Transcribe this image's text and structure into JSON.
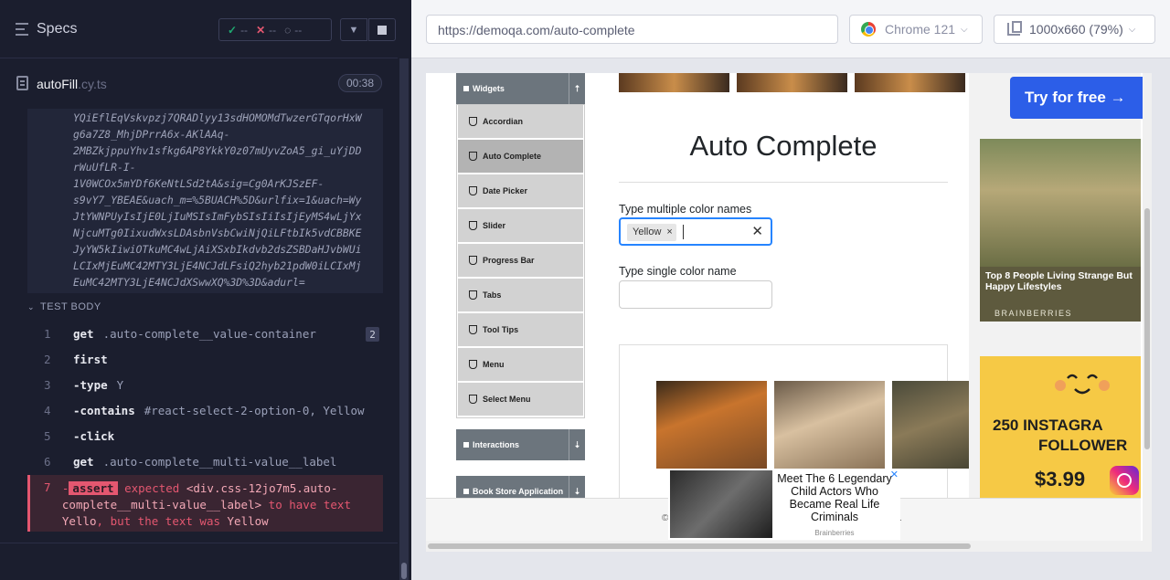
{
  "specs": {
    "title": "Specs",
    "stats": {
      "passed": "--",
      "failed": "--",
      "pending": "--"
    }
  },
  "spec_file": {
    "name": "autoFill",
    "ext": ".cy.ts",
    "time": "00:38"
  },
  "url_fragment": "YQiEflEqVskvpzj7QRADlyy13sdHOMOMdTwzerGTqorHxW\ng6a7Z8_MhjDPrrA6x-AKlAAq-\n2MBZkjppuYhv1sfkg6AP8YkkY0z07mUyvZoA5_gi_uYjDD\nrWuUfLR-I-\n1V0WCOx5mYDf6KeNtLSd2tA&sig=Cg0ArKJSzEF-\ns9vY7_YBEAE&uach_m=%5BUACH%5D&urlfix=1&uach=Wy\nJtYWNPUyIsIjE0LjIuMSIsImFybSIsIiIsIjEyMS4wLjYx\nNjcuMTg0IixudWxsLDAsbnVsbCwiNjQiLFtbIk5vdCBBKE\nJyYW5kIiwiOTkuMC4wLjAiXSxbIkdvb2dsZSBDaHJvbWUi\nLCIxMjEuMC42MTY3LjE4NCJdLFsiQ2hyb21pdW0iLCIxMj\nEuMC42MTY3LjE4NCJdXSwwXQ%3D%3D&adurl=",
  "test_body": {
    "header": "TEST BODY",
    "commands": [
      {
        "num": "1",
        "name": "get",
        "msg": ".auto-complete__value-container",
        "badge": "2"
      },
      {
        "num": "2",
        "name": "first",
        "msg": ""
      },
      {
        "num": "3",
        "name": "-type",
        "msg": "Y"
      },
      {
        "num": "4",
        "name": "-contains",
        "msg": "#react-select-2-option-0, Yellow"
      },
      {
        "num": "5",
        "name": "-click",
        "msg": ""
      },
      {
        "num": "6",
        "name": "get",
        "msg": ".auto-complete__multi-value__label"
      }
    ],
    "error": {
      "num": "7",
      "prefix": "-",
      "assert": "assert",
      "expected": "expected",
      "selector": "<div.css-12jo7m5.auto-complete__multi-value__label>",
      "to_have_text": "to have text",
      "expected_text": "Yello",
      "but": ", but the text was",
      "actual_text": "Yellow"
    }
  },
  "browser": {
    "url": "https://demoqa.com/auto-complete",
    "name": "Chrome 121",
    "viewport": "1000x660",
    "zoom": "(79%)"
  },
  "aut": {
    "sidebar": {
      "group_widgets": "Widgets",
      "items": [
        "Accordian",
        "Auto Complete",
        "Date Picker",
        "Slider",
        "Progress Bar",
        "Tabs",
        "Tool Tips",
        "Menu",
        "Select Menu"
      ],
      "group_interactions": "Interactions",
      "group_bookstore": "Book Store Application"
    },
    "page_title": "Auto Complete",
    "multi_label": "Type multiple color names",
    "chip_value": "Yellow",
    "single_label": "Type single color name",
    "ads": {
      "try_button": "Try for free →",
      "ad1_text": "Top 8 People Living Strange But Happy Lifestyles",
      "ad1_brand": "BRAINBERRIES",
      "ad2_line1": "250 INSTAGRA",
      "ad2_line2": "FOLLOWER",
      "ad2_price": "$3.99",
      "popup_title": "Meet The 6 Legendary Child Actors Who Became Real Life Criminals",
      "popup_brand": "Brainberries",
      "footer_left": "©",
      "footer_right": "."
    }
  }
}
